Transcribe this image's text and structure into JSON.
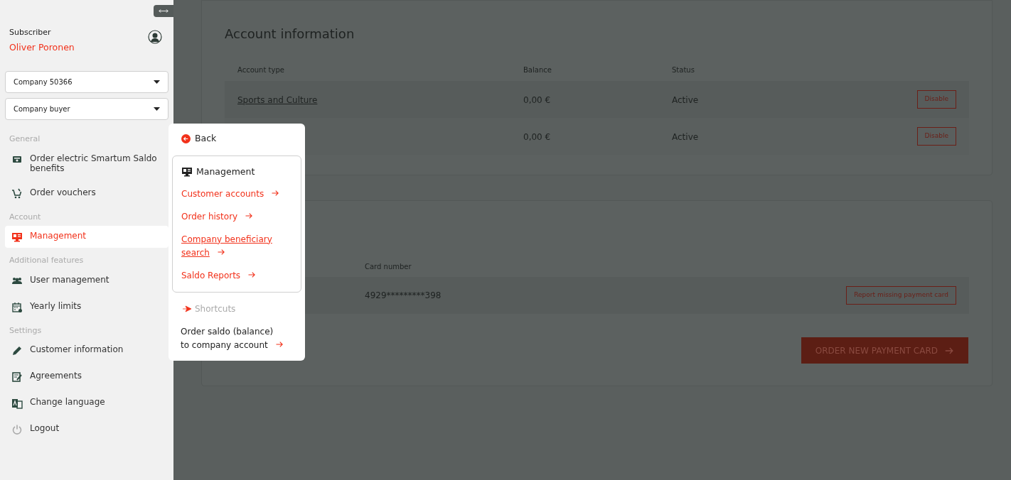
{
  "sidebar": {
    "subscriber_label": "Subscriber",
    "subscriber_name": "Oliver Poronen",
    "selects": [
      {
        "value": "Company 50366"
      },
      {
        "value": "Company buyer"
      }
    ],
    "sections": [
      {
        "title": "General",
        "items": [
          {
            "label": "Order electric Smartum Saldo benefits",
            "selected": false
          },
          {
            "label": "Order vouchers",
            "selected": false
          }
        ]
      },
      {
        "title": "Account",
        "items": [
          {
            "label": "Management",
            "selected": true
          }
        ]
      },
      {
        "title": "Additional features",
        "items": [
          {
            "label": "User management",
            "selected": false
          },
          {
            "label": "Yearly limits",
            "selected": false
          }
        ]
      },
      {
        "title": "Settings",
        "items": [
          {
            "label": "Customer information",
            "selected": false
          },
          {
            "label": "Agreements",
            "selected": false
          },
          {
            "label": "Change language",
            "selected": false
          },
          {
            "label": "Logout",
            "selected": false
          }
        ]
      }
    ]
  },
  "account_information": {
    "title": "Account information",
    "columns": [
      "Account type",
      "Balance",
      "Status"
    ],
    "rows": [
      {
        "account_type": "Sports and Culture",
        "balance": "0,00 €",
        "status": "Active",
        "action": "Disable"
      },
      {
        "balance": "0,00 €",
        "status": "Active",
        "action": "Disable"
      }
    ]
  },
  "payment_cards": {
    "columns": [
      "Card number"
    ],
    "rows": [
      {
        "card_number": "4929*********398",
        "action": "Report missing payment card"
      }
    ],
    "order_button": "ORDER NEW PAYMENT CARD"
  },
  "submenu": {
    "back": "Back",
    "title": "Management",
    "links": [
      {
        "label": "Customer accounts",
        "underlined": false
      },
      {
        "label": "Order history",
        "underlined": false
      },
      {
        "label": "Company beneficiary search",
        "underlined": true
      },
      {
        "label": "Saldo Reports",
        "underlined": false
      }
    ],
    "shortcuts_title": "Shortcuts",
    "shortcuts": [
      {
        "label": "Order saldo (balance) to company account"
      }
    ]
  }
}
